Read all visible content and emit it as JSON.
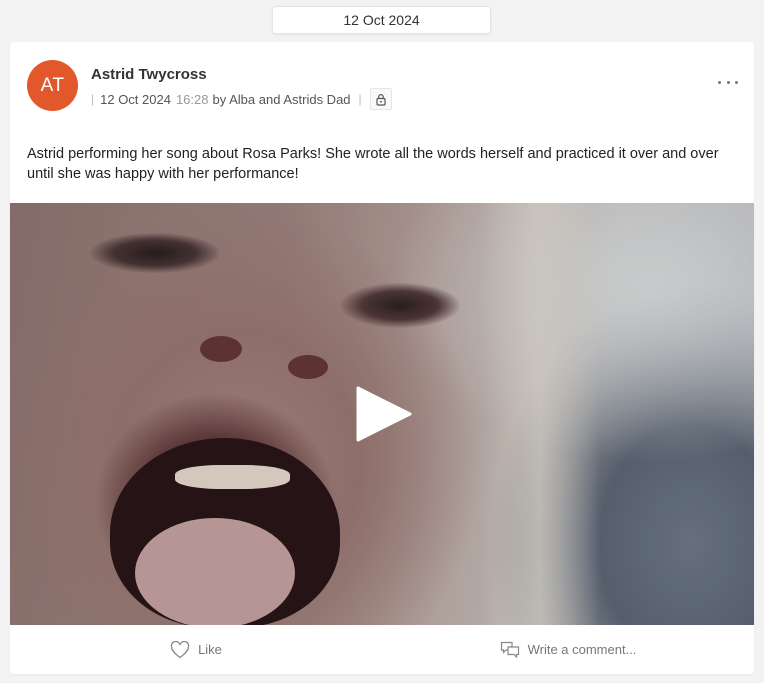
{
  "date_header": "12 Oct 2024",
  "post": {
    "avatar_initials": "AT",
    "avatar_color": "#e3582b",
    "author": "Astrid Twycross",
    "date": "12 Oct 2024",
    "time": "16:28",
    "by": "by Alba and Astrids Dad",
    "privacy_icon": "lock-icon",
    "menu_icon": "more-horizontal-icon",
    "text": "Astrid performing her song about Rosa Parks! She wrote all the words herself and practiced it over and over until she was happy with her performance!",
    "video": {
      "play_icon": "play-icon"
    }
  },
  "actions": {
    "like_label": "Like",
    "like_icon": "heart-icon",
    "comment_label": "Write a comment...",
    "comment_icon": "comment-bubbles-icon"
  }
}
